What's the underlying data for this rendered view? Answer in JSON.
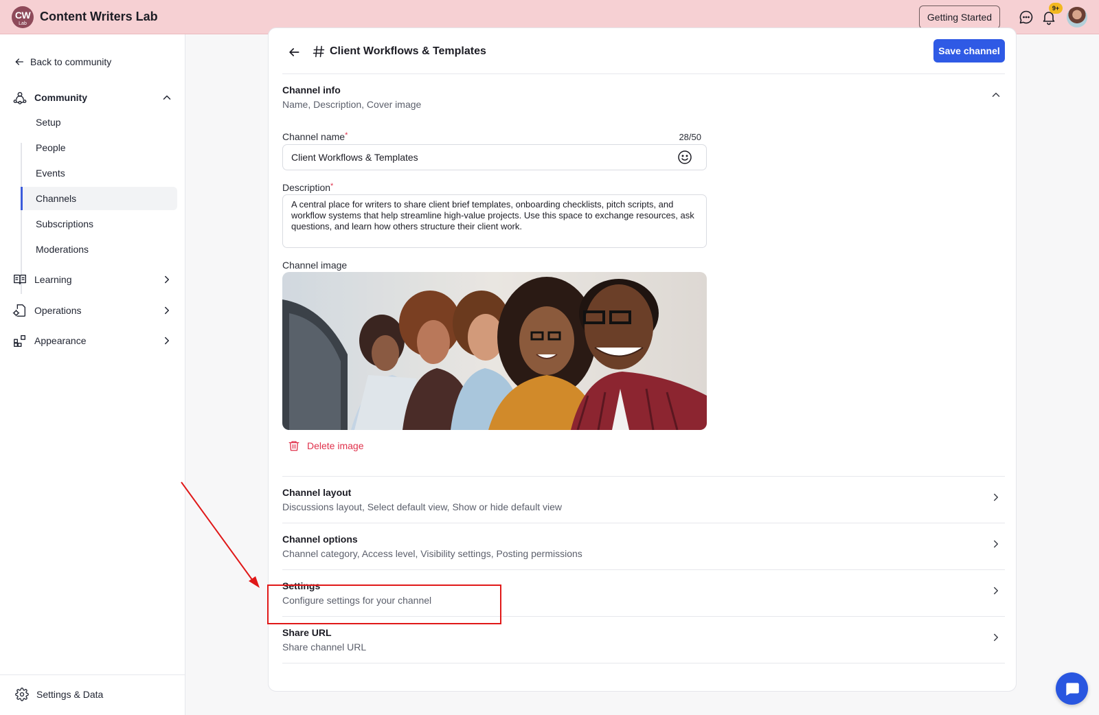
{
  "app": {
    "logo_text": "CW",
    "logo_subtext": "Lab",
    "title": "Content Writers Lab",
    "getting_started_label": "Getting Started",
    "notification_badge": "9+"
  },
  "sidebar": {
    "back_label": "Back to community",
    "community_label": "Community",
    "sub_items": [
      "Setup",
      "People",
      "Events",
      "Channels",
      "Subscriptions",
      "Moderations"
    ],
    "active_item": "Channels",
    "learning_label": "Learning",
    "operations_label": "Operations",
    "appearance_label": "Appearance",
    "settings_data_label": "Settings & Data"
  },
  "channel": {
    "title": "Client Workflows & Templates",
    "save_label": "Save channel",
    "info": {
      "title": "Channel info",
      "subtitle": "Name, Description, Cover image"
    },
    "name_label": "Channel name",
    "required_mark": "*",
    "name_counter": "28/50",
    "name_value": "Client Workflows & Templates",
    "description_label": "Description",
    "description_value": "A central place for writers to share client brief templates, onboarding checklists, pitch scripts, and workflow systems that help streamline high-value projects. Use this space to exchange resources, ask questions, and learn how others structure their client work.",
    "image_label": "Channel image",
    "delete_image_label": "Delete image",
    "sections": [
      {
        "title": "Channel layout",
        "subtitle": "Discussions layout, Select default view, Show or hide default view"
      },
      {
        "title": "Channel options",
        "subtitle": "Channel category, Access level, Visibility settings, Posting permissions"
      },
      {
        "title": "Settings",
        "subtitle": "Configure settings for your channel"
      },
      {
        "title": "Share URL",
        "subtitle": "Share channel URL"
      }
    ]
  },
  "colors": {
    "topbar": "#f6d0d3",
    "primary": "#2f5ae5",
    "danger": "#e0314b",
    "annotation": "#e01818"
  }
}
